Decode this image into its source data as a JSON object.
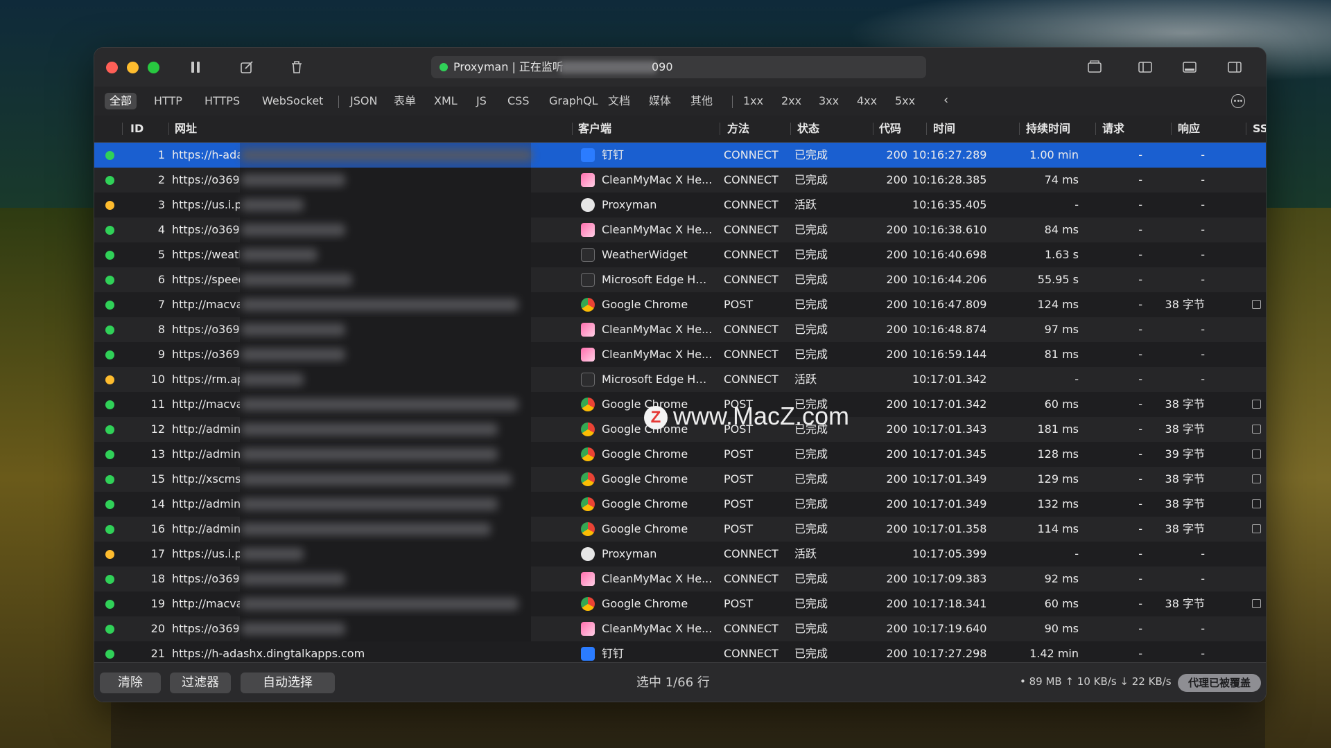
{
  "window": {
    "title": "Proxyman | 正在监听",
    "port": "090",
    "status_color": "#30d158"
  },
  "filters": [
    "全部",
    "HTTP",
    "HTTPS",
    "WebSocket",
    "JSON",
    "表单",
    "XML",
    "JS",
    "CSS",
    "GraphQL",
    "文档",
    "媒体",
    "其他",
    "1xx",
    "2xx",
    "3xx",
    "4xx",
    "5xx"
  ],
  "filter_active": "全部",
  "columns": {
    "id": "ID",
    "url": "网址",
    "client": "客户端",
    "method": "方法",
    "status": "状态",
    "code": "代码",
    "time": "时间",
    "duration": "持续时间",
    "request": "请求",
    "response": "响应",
    "ss": "SS"
  },
  "rows": [
    {
      "dot": "green",
      "id": "1",
      "url": "https://h-ada",
      "client": "钉钉",
      "icon": "dingtalk",
      "method": "CONNECT",
      "status": "已完成",
      "code": "200",
      "time": "10:16:27.289",
      "duration": "1.00 min",
      "request": "-",
      "response": "-",
      "selected": true
    },
    {
      "dot": "green",
      "id": "2",
      "url": "https://o369",
      "client": "CleanMyMac X He...",
      "icon": "cleanmymac",
      "method": "CONNECT",
      "status": "已完成",
      "code": "200",
      "time": "10:16:28.385",
      "duration": "74 ms",
      "request": "-",
      "response": "-"
    },
    {
      "dot": "yellow",
      "id": "3",
      "url": "https://us.i.p",
      "client": "Proxyman",
      "icon": "proxyman",
      "method": "CONNECT",
      "status": "活跃",
      "code": "",
      "time": "10:16:35.405",
      "duration": "-",
      "request": "-",
      "response": "-"
    },
    {
      "dot": "green",
      "id": "4",
      "url": "https://o369",
      "client": "CleanMyMac X He...",
      "icon": "cleanmymac",
      "method": "CONNECT",
      "status": "已完成",
      "code": "200",
      "time": "10:16:38.610",
      "duration": "84 ms",
      "request": "-",
      "response": "-"
    },
    {
      "dot": "green",
      "id": "5",
      "url": "https://weath",
      "client": "WeatherWidget",
      "icon": "generic",
      "method": "CONNECT",
      "status": "已完成",
      "code": "200",
      "time": "10:16:40.698",
      "duration": "1.63 s",
      "request": "-",
      "response": "-"
    },
    {
      "dot": "green",
      "id": "6",
      "url": "https://speec",
      "client": "Microsoft Edge Hel...",
      "icon": "generic",
      "method": "CONNECT",
      "status": "已完成",
      "code": "200",
      "time": "10:16:44.206",
      "duration": "55.95 s",
      "request": "-",
      "response": "-"
    },
    {
      "dot": "green",
      "id": "7",
      "url": "http://macva",
      "client": "Google Chrome",
      "icon": "chrome",
      "method": "POST",
      "status": "已完成",
      "code": "200",
      "time": "10:16:47.809",
      "duration": "124 ms",
      "request": "-",
      "response": "38 字节",
      "ss": true
    },
    {
      "dot": "green",
      "id": "8",
      "url": "https://o369",
      "client": "CleanMyMac X He...",
      "icon": "cleanmymac",
      "method": "CONNECT",
      "status": "已完成",
      "code": "200",
      "time": "10:16:48.874",
      "duration": "97 ms",
      "request": "-",
      "response": "-"
    },
    {
      "dot": "green",
      "id": "9",
      "url": "https://o369",
      "client": "CleanMyMac X He...",
      "icon": "cleanmymac",
      "method": "CONNECT",
      "status": "已完成",
      "code": "200",
      "time": "10:16:59.144",
      "duration": "81 ms",
      "request": "-",
      "response": "-"
    },
    {
      "dot": "yellow",
      "id": "10",
      "url": "https://rm.ap",
      "client": "Microsoft Edge Hel...",
      "icon": "generic",
      "method": "CONNECT",
      "status": "活跃",
      "code": "",
      "time": "10:17:01.342",
      "duration": "-",
      "request": "-",
      "response": "-"
    },
    {
      "dot": "green",
      "id": "11",
      "url": "http://macva",
      "client": "Google Chrome",
      "icon": "chrome",
      "method": "POST",
      "status": "已完成",
      "code": "200",
      "time": "10:17:01.342",
      "duration": "60 ms",
      "request": "-",
      "response": "38 字节",
      "ss": true
    },
    {
      "dot": "green",
      "id": "12",
      "url": "http://admin.",
      "client": "Google Chrome",
      "icon": "chrome",
      "method": "POST",
      "status": "已完成",
      "code": "200",
      "time": "10:17:01.343",
      "duration": "181 ms",
      "request": "-",
      "response": "38 字节",
      "ss": true
    },
    {
      "dot": "green",
      "id": "13",
      "url": "http://admin.",
      "client": "Google Chrome",
      "icon": "chrome",
      "method": "POST",
      "status": "已完成",
      "code": "200",
      "time": "10:17:01.345",
      "duration": "128 ms",
      "request": "-",
      "response": "39 字节",
      "ss": true
    },
    {
      "dot": "green",
      "id": "15",
      "url": "http://xscms.",
      "client": "Google Chrome",
      "icon": "chrome",
      "method": "POST",
      "status": "已完成",
      "code": "200",
      "time": "10:17:01.349",
      "duration": "129 ms",
      "request": "-",
      "response": "38 字节",
      "ss": true
    },
    {
      "dot": "green",
      "id": "14",
      "url": "http://admin.",
      "client": "Google Chrome",
      "icon": "chrome",
      "method": "POST",
      "status": "已完成",
      "code": "200",
      "time": "10:17:01.349",
      "duration": "132 ms",
      "request": "-",
      "response": "38 字节",
      "ss": true
    },
    {
      "dot": "green",
      "id": "16",
      "url": "http://admin.",
      "client": "Google Chrome",
      "icon": "chrome",
      "method": "POST",
      "status": "已完成",
      "code": "200",
      "time": "10:17:01.358",
      "duration": "114 ms",
      "request": "-",
      "response": "38 字节",
      "ss": true
    },
    {
      "dot": "yellow",
      "id": "17",
      "url": "https://us.i.p",
      "client": "Proxyman",
      "icon": "proxyman",
      "method": "CONNECT",
      "status": "活跃",
      "code": "",
      "time": "10:17:05.399",
      "duration": "-",
      "request": "-",
      "response": "-"
    },
    {
      "dot": "green",
      "id": "18",
      "url": "https://o369",
      "client": "CleanMyMac X He...",
      "icon": "cleanmymac",
      "method": "CONNECT",
      "status": "已完成",
      "code": "200",
      "time": "10:17:09.383",
      "duration": "92 ms",
      "request": "-",
      "response": "-"
    },
    {
      "dot": "green",
      "id": "19",
      "url": "http://macva",
      "client": "Google Chrome",
      "icon": "chrome",
      "method": "POST",
      "status": "已完成",
      "code": "200",
      "time": "10:17:18.341",
      "duration": "60 ms",
      "request": "-",
      "response": "38 字节",
      "ss": true
    },
    {
      "dot": "green",
      "id": "20",
      "url": "https://o369",
      "client": "CleanMyMac X He...",
      "icon": "cleanmymac",
      "method": "CONNECT",
      "status": "已完成",
      "code": "200",
      "time": "10:17:19.640",
      "duration": "90 ms",
      "request": "-",
      "response": "-"
    },
    {
      "dot": "green",
      "id": "21",
      "url": "https://h-adashx.dingtalkapps.com",
      "client": "钉钉",
      "icon": "dingtalk",
      "method": "CONNECT",
      "status": "已完成",
      "code": "200",
      "time": "10:17:27.298",
      "duration": "1.42 min",
      "request": "-",
      "response": "-",
      "full_url": true
    }
  ],
  "footer": {
    "clear": "清除",
    "filter": "过滤器",
    "auto_select": "自动选择",
    "selection": "选中 1/66 行",
    "stats": "• 89 MB ↑ 10 KB/s ↓ 22 KB/s",
    "proxy_badge": "代理已被覆盖"
  },
  "watermark": "www.MacZ.com",
  "colors": {
    "selected_row": "#1a5fd0",
    "dot_green": "#30d158",
    "dot_yellow": "#febc2e"
  }
}
